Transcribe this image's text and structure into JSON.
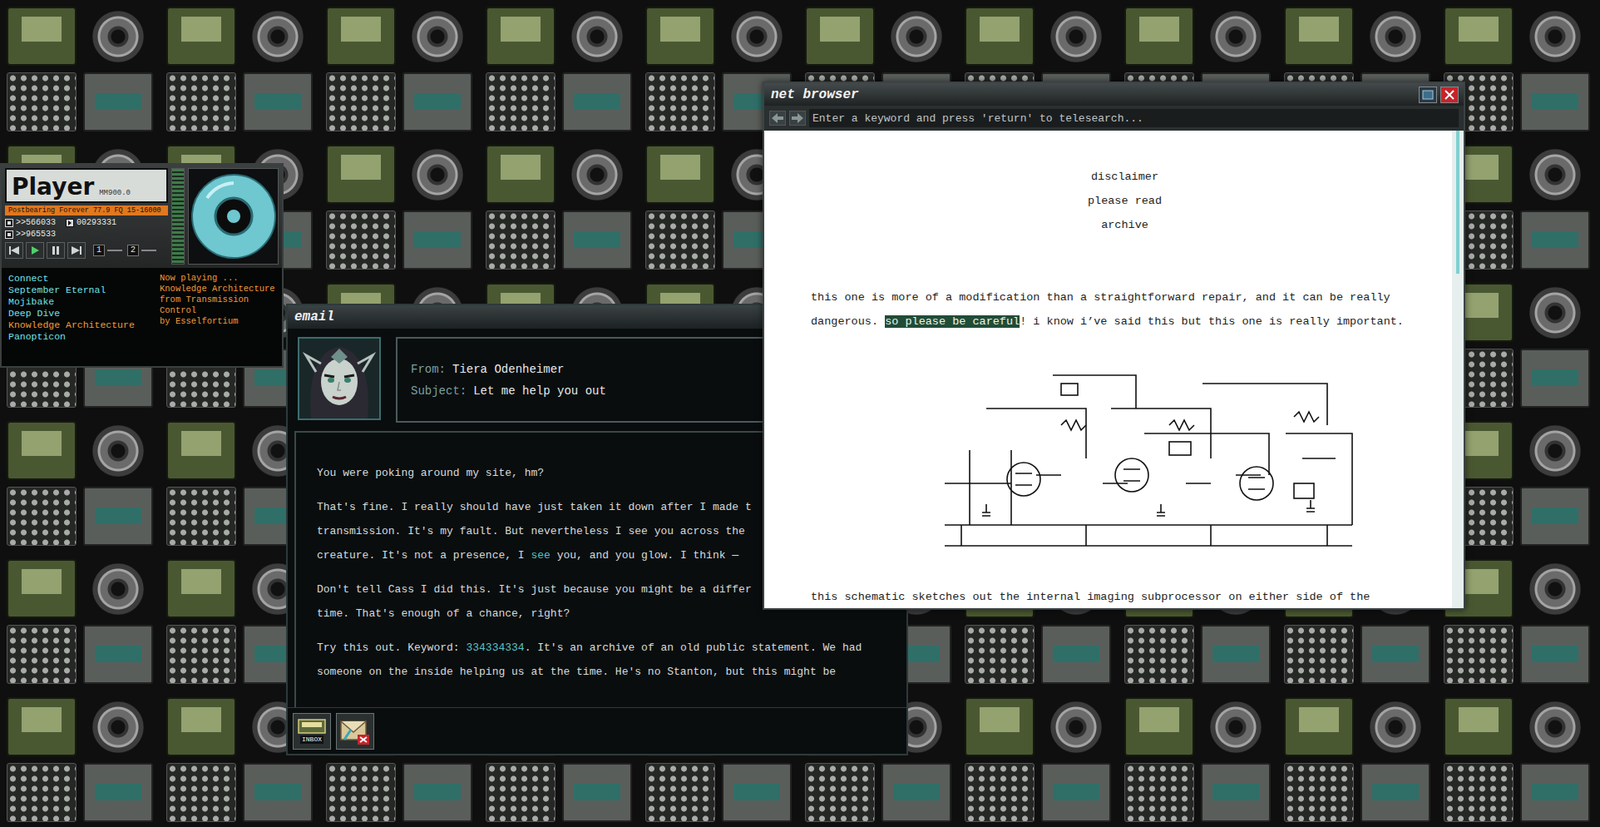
{
  "player": {
    "logo": "Player",
    "model": "MM900.0",
    "station": "Postbearing Forever 77.9 FQ 15-16000",
    "readouts": [
      ">>566033",
      ">>965533"
    ],
    "counter": "00293331",
    "channels": [
      "1",
      "2"
    ],
    "tracks": [
      {
        "label": "Connect",
        "selected": false
      },
      {
        "label": "September Eternal",
        "selected": false
      },
      {
        "label": "Mojibake",
        "selected": false
      },
      {
        "label": "Deep Dive",
        "selected": false
      },
      {
        "label": "Knowledge Architecture",
        "selected": true
      },
      {
        "label": "Panopticon",
        "selected": false
      }
    ],
    "now_playing": {
      "label": "Now playing ...",
      "track": "Knowledge Architecture",
      "source": "from Transmission Control",
      "artist": "by Esselfortium"
    }
  },
  "email": {
    "title": "email",
    "from_label": "From:",
    "from": "Tiera Odenheimer",
    "subject_label": "Subject:",
    "subject": "Let me help you out",
    "paragraphs": [
      [
        [
          {
            "text": "You were poking around my site, hm?",
            "highlight": false
          }
        ]
      ],
      [
        [
          {
            "text": "That's fine. I really should have just taken it down after I made t",
            "highlight": false
          }
        ],
        [
          {
            "text": "transmission. It's my fault. But nevertheless I see you across the",
            "highlight": false
          }
        ],
        [
          {
            "text": "creature. It's not a presence, I ",
            "highlight": false
          },
          {
            "text": "see",
            "highlight": true
          },
          {
            "text": " you, and you glow. I think —",
            "highlight": false
          }
        ]
      ],
      [
        [
          {
            "text": "Don't tell Cass I did this. It's just because you might be a differ",
            "highlight": false
          }
        ],
        [
          {
            "text": "time. That's enough of a chance, right?",
            "highlight": false
          }
        ]
      ],
      [
        [
          {
            "text": "Try this out. Keyword: ",
            "highlight": false
          },
          {
            "text": "334334334",
            "highlight": true
          },
          {
            "text": ". It's an archive of an old public statement. We had",
            "highlight": false
          }
        ],
        [
          {
            "text": "someone on the inside helping us at the time. He's no Stanton, but this might be",
            "highlight": false
          }
        ]
      ]
    ],
    "inbox_label": "INBOX"
  },
  "browser": {
    "title": "net browser",
    "search": {
      "placeholder": "Enter a keyword and press 'return' to telesearch..."
    },
    "links": [
      "disclaimer",
      "please read",
      "archive"
    ],
    "paragraph": [
      [
        {
          "text": "this one is more of a modification than a straightforward repair, and it can be really",
          "highlight": false
        }
      ],
      [
        {
          "text": "dangerous. ",
          "highlight": false
        },
        {
          "text": "so please be careful",
          "highlight": true
        },
        {
          "text": "! i know i’ve said this but this one is really important.",
          "highlight": false
        }
      ]
    ],
    "caption": "this schematic sketches out the internal imaging subprocessor on either side of the",
    "scrollbar": {
      "level": 0.3
    }
  }
}
